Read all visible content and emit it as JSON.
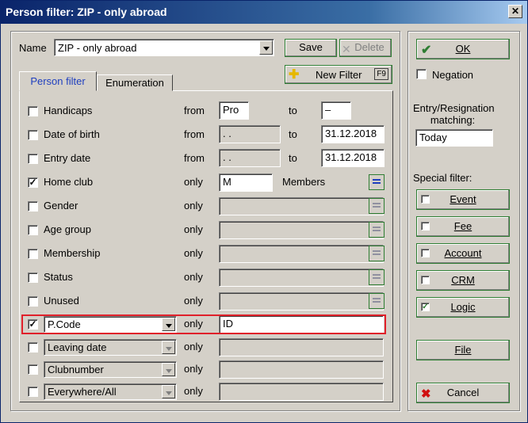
{
  "window": {
    "title": "Person filter: ZIP - only abroad",
    "close": "✕"
  },
  "name_row": {
    "label": "Name",
    "value": "ZIP - only abroad",
    "save": "Save",
    "delete": "Delete"
  },
  "new_filter": {
    "label": "New Filter",
    "shortcut": "F9"
  },
  "tabs": [
    {
      "label": "Person filter",
      "active": true
    },
    {
      "label": "Enumeration",
      "active": false
    }
  ],
  "rows": [
    {
      "label": "Handicaps",
      "checked": false,
      "mode": "from",
      "from": "Pro",
      "to_label": "to",
      "to": "–"
    },
    {
      "label": "Date of birth",
      "checked": false,
      "mode": "from",
      "from": " . .",
      "to_label": "to",
      "to": "31.12.2018"
    },
    {
      "label": "Entry date",
      "checked": false,
      "mode": "from",
      "from": " . .",
      "to_label": "to",
      "to": "31.12.2018"
    },
    {
      "label": "Home club",
      "checked": true,
      "mode": "only",
      "value": "M",
      "suffix": "Members"
    },
    {
      "label": "Gender",
      "checked": false,
      "mode": "only",
      "value": ""
    },
    {
      "label": "Age group",
      "checked": false,
      "mode": "only",
      "value": ""
    },
    {
      "label": "Membership",
      "checked": false,
      "mode": "only",
      "value": ""
    },
    {
      "label": "Status",
      "checked": false,
      "mode": "only",
      "value": ""
    },
    {
      "label": "Unused",
      "checked": false,
      "mode": "only",
      "value": ""
    },
    {
      "label": "P.Code",
      "checked": true,
      "mode": "only",
      "value": "ID",
      "combo": true,
      "highlight": true
    },
    {
      "label": "Leaving date",
      "checked": false,
      "mode": "only",
      "value": "",
      "combo": true
    },
    {
      "label": "Clubnumber",
      "checked": false,
      "mode": "only",
      "value": "",
      "combo": true
    },
    {
      "label": "Everywhere/All",
      "checked": false,
      "mode": "only",
      "value": "",
      "combo": true
    }
  ],
  "right": {
    "ok": "OK",
    "negation": "Negation",
    "entry_label": "Entry/Resignation matching:",
    "entry_value": "Today",
    "special_label": "Special filter:",
    "special": [
      {
        "label": "Event",
        "checked": false
      },
      {
        "label": "Fee",
        "checked": false
      },
      {
        "label": "Account",
        "checked": false
      },
      {
        "label": "CRM",
        "checked": false
      },
      {
        "label": "Logic",
        "checked": true
      }
    ],
    "file": "File",
    "cancel": "Cancel"
  },
  "colors": {
    "title_bar": "#0a246a",
    "highlight": "#e0202a",
    "accent_green": "#2e7d32"
  }
}
